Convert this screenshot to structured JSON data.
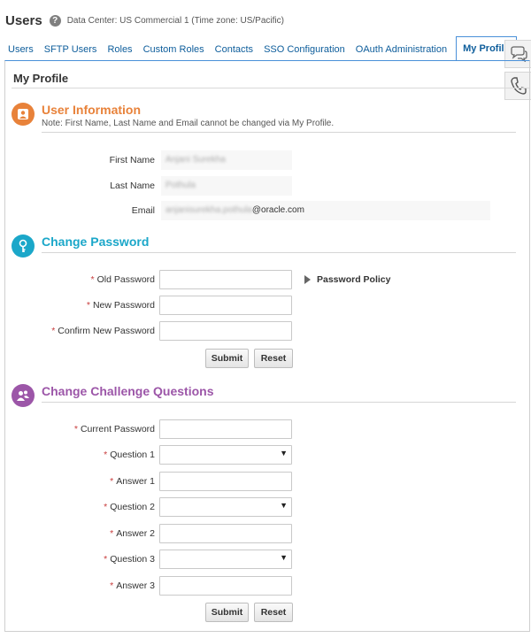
{
  "header": {
    "title": "Users",
    "help_glyph": "?",
    "data_center": "Data Center: US Commercial 1 (Time zone: US/Pacific)"
  },
  "tabs": [
    {
      "label": "Users"
    },
    {
      "label": "SFTP Users"
    },
    {
      "label": "Roles"
    },
    {
      "label": "Custom Roles"
    },
    {
      "label": "Contacts"
    },
    {
      "label": "SSO Configuration"
    },
    {
      "label": "OAuth Administration"
    },
    {
      "label": "My Profile",
      "active": true
    }
  ],
  "side_rail": {
    "icons": [
      "chat-icon",
      "phone-icon"
    ]
  },
  "content": {
    "title": "My Profile"
  },
  "user_info": {
    "title": "User Information",
    "note": "Note: First Name, Last Name and Email cannot be changed via My Profile.",
    "color": "#e8823a",
    "icon": "user-icon",
    "first_name_label": "First Name",
    "first_name_value": "Anjani Surekha",
    "last_name_label": "Last Name",
    "last_name_value": "Pothula",
    "email_label": "Email",
    "email_value_hidden": "anjanisurekha.pothula",
    "email_value_domain": "@oracle.com"
  },
  "change_password": {
    "title": "Change Password",
    "color": "#1ba7c9",
    "icon": "key-icon",
    "required_mark": "*",
    "old_password_label": "Old Password",
    "new_password_label": "New Password",
    "confirm_password_label": "Confirm New Password",
    "policy_label": "Password Policy",
    "submit_label": "Submit",
    "reset_label": "Reset"
  },
  "challenge": {
    "title": "Change Challenge Questions",
    "color": "#9c56a8",
    "icon": "users-icon",
    "required_mark": "*",
    "current_password_label": "Current Password",
    "question1_label": "Question 1",
    "answer1_label": "Answer 1",
    "question2_label": "Question 2",
    "answer2_label": "Answer 2",
    "question3_label": "Question 3",
    "answer3_label": "Answer 3",
    "dropdown_glyph": "▼",
    "submit_label": "Submit",
    "reset_label": "Reset"
  }
}
